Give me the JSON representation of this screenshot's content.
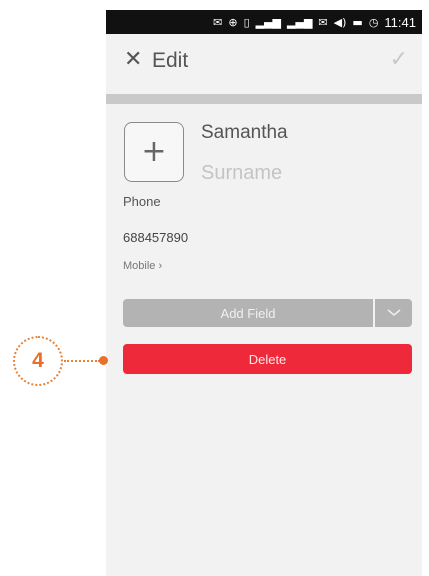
{
  "statusbar": {
    "time": "11:41",
    "icons": [
      "mail-icon",
      "location-icon",
      "sim-icon",
      "signal-icon",
      "signal-icon",
      "message-icon",
      "volume-icon",
      "battery-icon",
      "alarm-icon"
    ]
  },
  "header": {
    "title": "Edit",
    "close_icon": "close-icon",
    "confirm_icon": "check-icon"
  },
  "contact": {
    "first_name": "Samantha",
    "surname_placeholder": "Surname",
    "phone_label": "Phone",
    "phone_number": "688457890",
    "phone_type": "Mobile ›"
  },
  "actions": {
    "add_field_label": "Add Field",
    "delete_label": "Delete"
  },
  "callout": {
    "number": "4"
  },
  "colors": {
    "accent_delete": "#ee2a3a",
    "callout_orange": "#e8702a",
    "button_grey": "#b3b3b3"
  }
}
